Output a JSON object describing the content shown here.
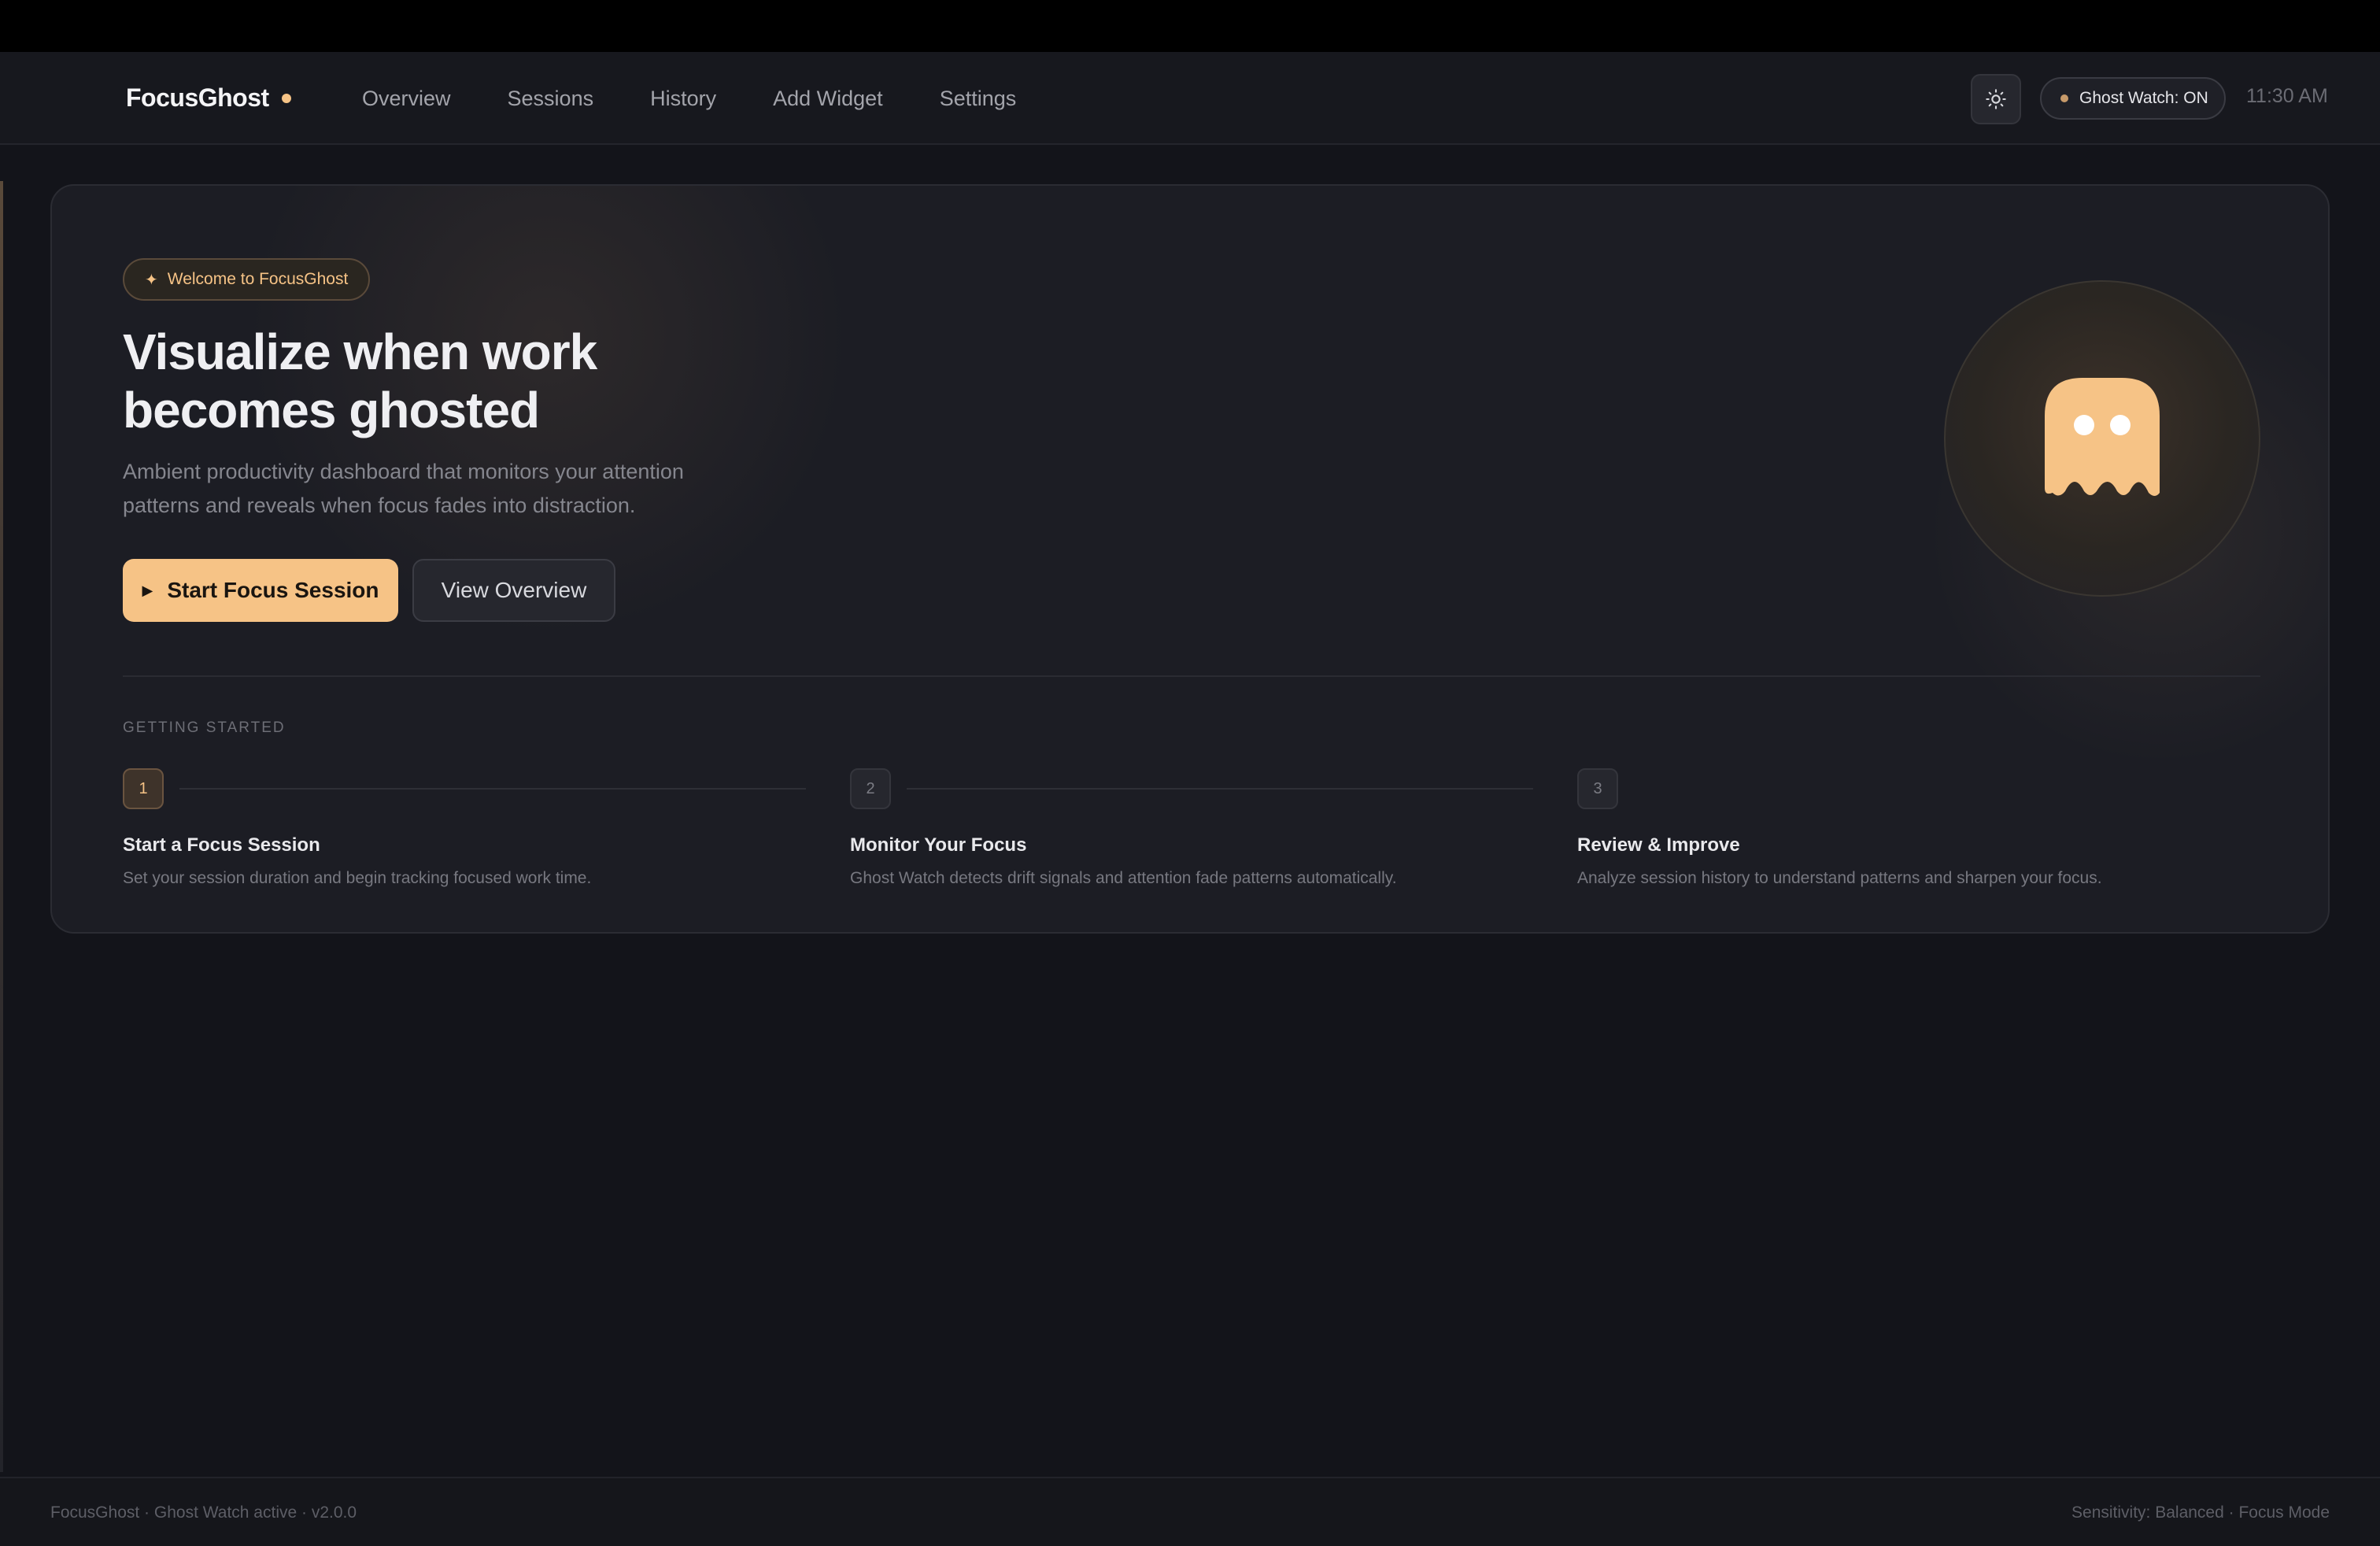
{
  "brand": {
    "name": "FocusGhost"
  },
  "nav": {
    "links": [
      "Overview",
      "Sessions",
      "History",
      "Add Widget",
      "Settings"
    ],
    "ghost_watch": "Ghost Watch: ON",
    "time": "11:30 AM",
    "theme_icon": "sun-icon"
  },
  "hero": {
    "badge": "Welcome to FocusGhost",
    "title_line1": "Visualize when work",
    "title_line2": "becomes ghosted",
    "subtitle": "Ambient productivity dashboard that monitors your attention patterns and reveals when focus fades into distraction.",
    "primary_button": "Start Focus Session",
    "secondary_button": "View Overview",
    "mascot_icon": "ghost-icon"
  },
  "getting_started": {
    "label": "GETTING STARTED",
    "steps": [
      {
        "number": "1",
        "title": "Start a Focus Session",
        "description": "Set your session duration and begin tracking focused work time."
      },
      {
        "number": "2",
        "title": "Monitor Your Focus",
        "description": "Ghost Watch detects drift signals and attention fade patterns automatically."
      },
      {
        "number": "3",
        "title": "Review & Improve",
        "description": "Analyze session history to understand patterns and sharpen your focus."
      }
    ]
  },
  "footer": {
    "left": "FocusGhost · Ghost Watch active · v2.0.0",
    "right": "Sensitivity: Balanced · Focus Mode"
  },
  "colors": {
    "accent": "#f6c386",
    "background": "#13141a",
    "card": "#1c1d24"
  }
}
